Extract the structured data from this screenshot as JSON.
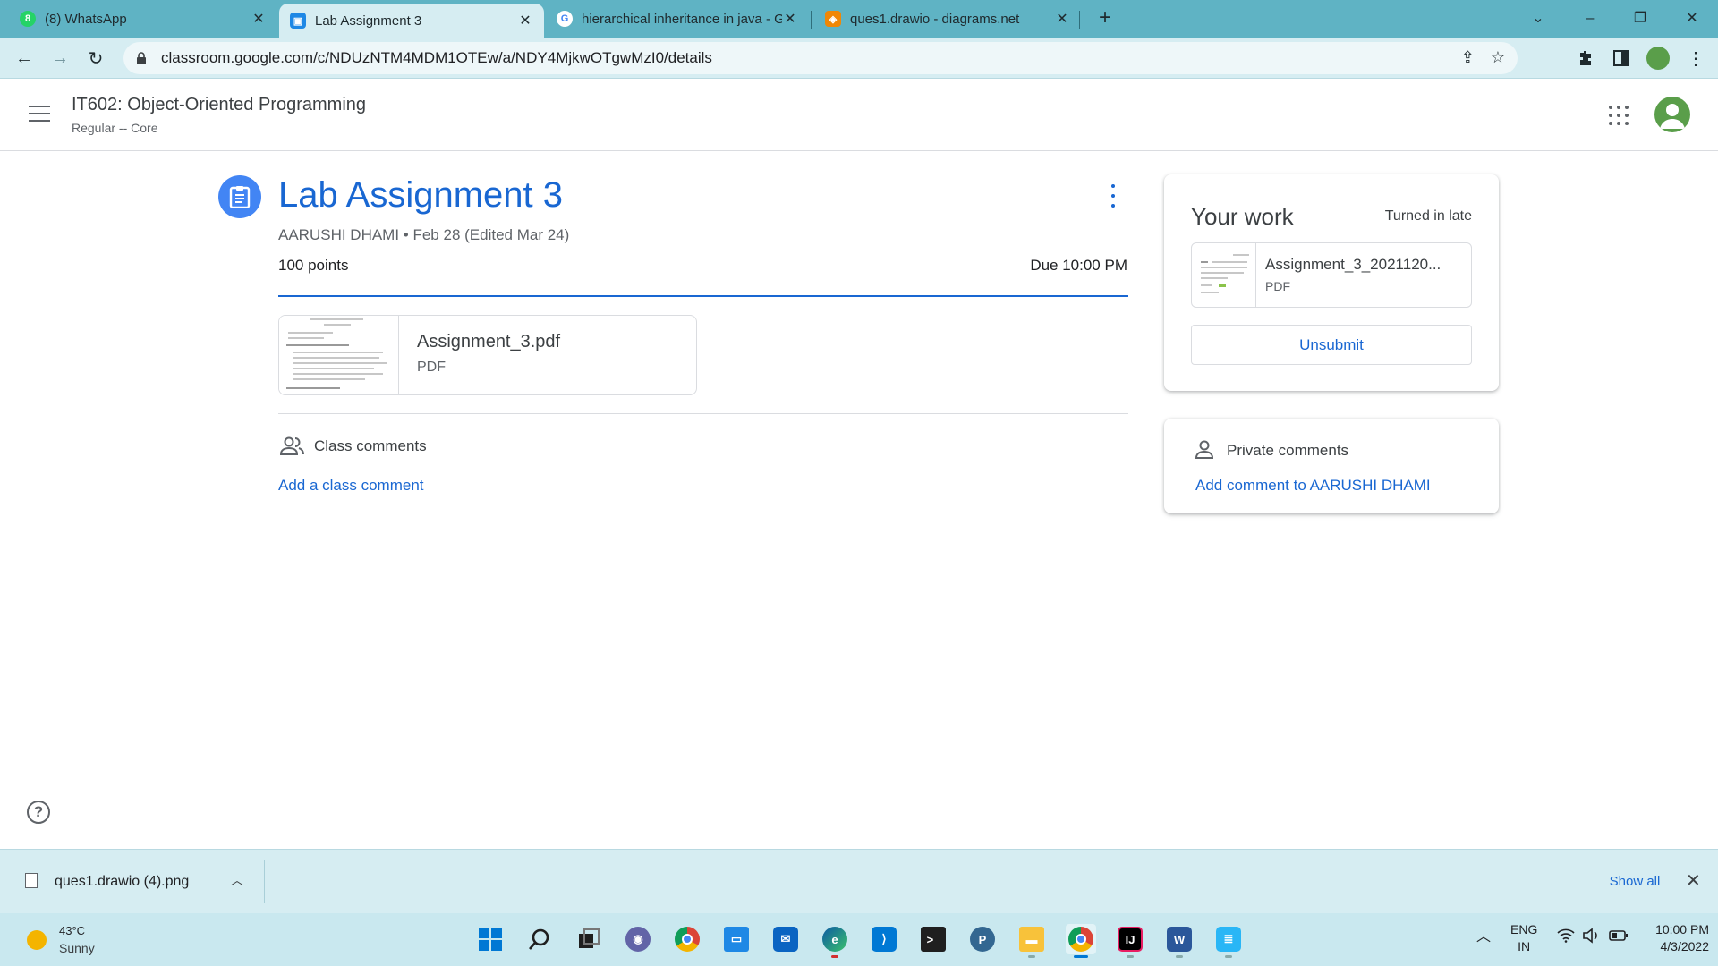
{
  "browser": {
    "tabs": [
      {
        "label": "(8) WhatsApp",
        "icon": "whatsapp-icon",
        "active": false
      },
      {
        "label": "Lab Assignment 3",
        "icon": "classroom-icon",
        "active": true
      },
      {
        "label": "hierarchical inheritance in java - G",
        "icon": "google-icon",
        "active": false
      },
      {
        "label": "ques1.drawio - diagrams.net",
        "icon": "drawio-icon",
        "active": false
      }
    ],
    "url": "classroom.google.com/c/NDUzNTM4MDM1OTEw/a/NDY4MjkwOTgwMzI0/details"
  },
  "header": {
    "course_title": "IT602: Object-Oriented Programming",
    "course_subtitle": "Regular -- Core"
  },
  "assignment": {
    "title": "Lab Assignment 3",
    "meta": "AARUSHI DHAMI • Feb 28 (Edited Mar 24)",
    "points": "100 points",
    "due": "Due 10:00 PM",
    "attachment": {
      "name": "Assignment_3.pdf",
      "type": "PDF"
    },
    "class_comments_label": "Class comments",
    "add_class_comment": "Add a class comment"
  },
  "your_work": {
    "title": "Your work",
    "status": "Turned in late",
    "file": {
      "name": "Assignment_3_2021120...",
      "type": "PDF"
    },
    "unsubmit_label": "Unsubmit"
  },
  "private_comments": {
    "label": "Private comments",
    "add": "Add comment to AARUSHI DHAMI"
  },
  "help_label": "?",
  "downloads": {
    "file": "ques1.drawio (4).png",
    "show_all": "Show all"
  },
  "taskbar": {
    "weather_temp": "43°C",
    "weather_condition": "Sunny",
    "lang_line1": "ENG",
    "lang_line2": "IN",
    "time": "10:00 PM",
    "date": "4/3/2022"
  },
  "colors": {
    "accent": "#1967d2",
    "chrome": "#5fb3c4",
    "chrome_light": "#d6edf2",
    "taskbar": "#c9e8ef"
  }
}
